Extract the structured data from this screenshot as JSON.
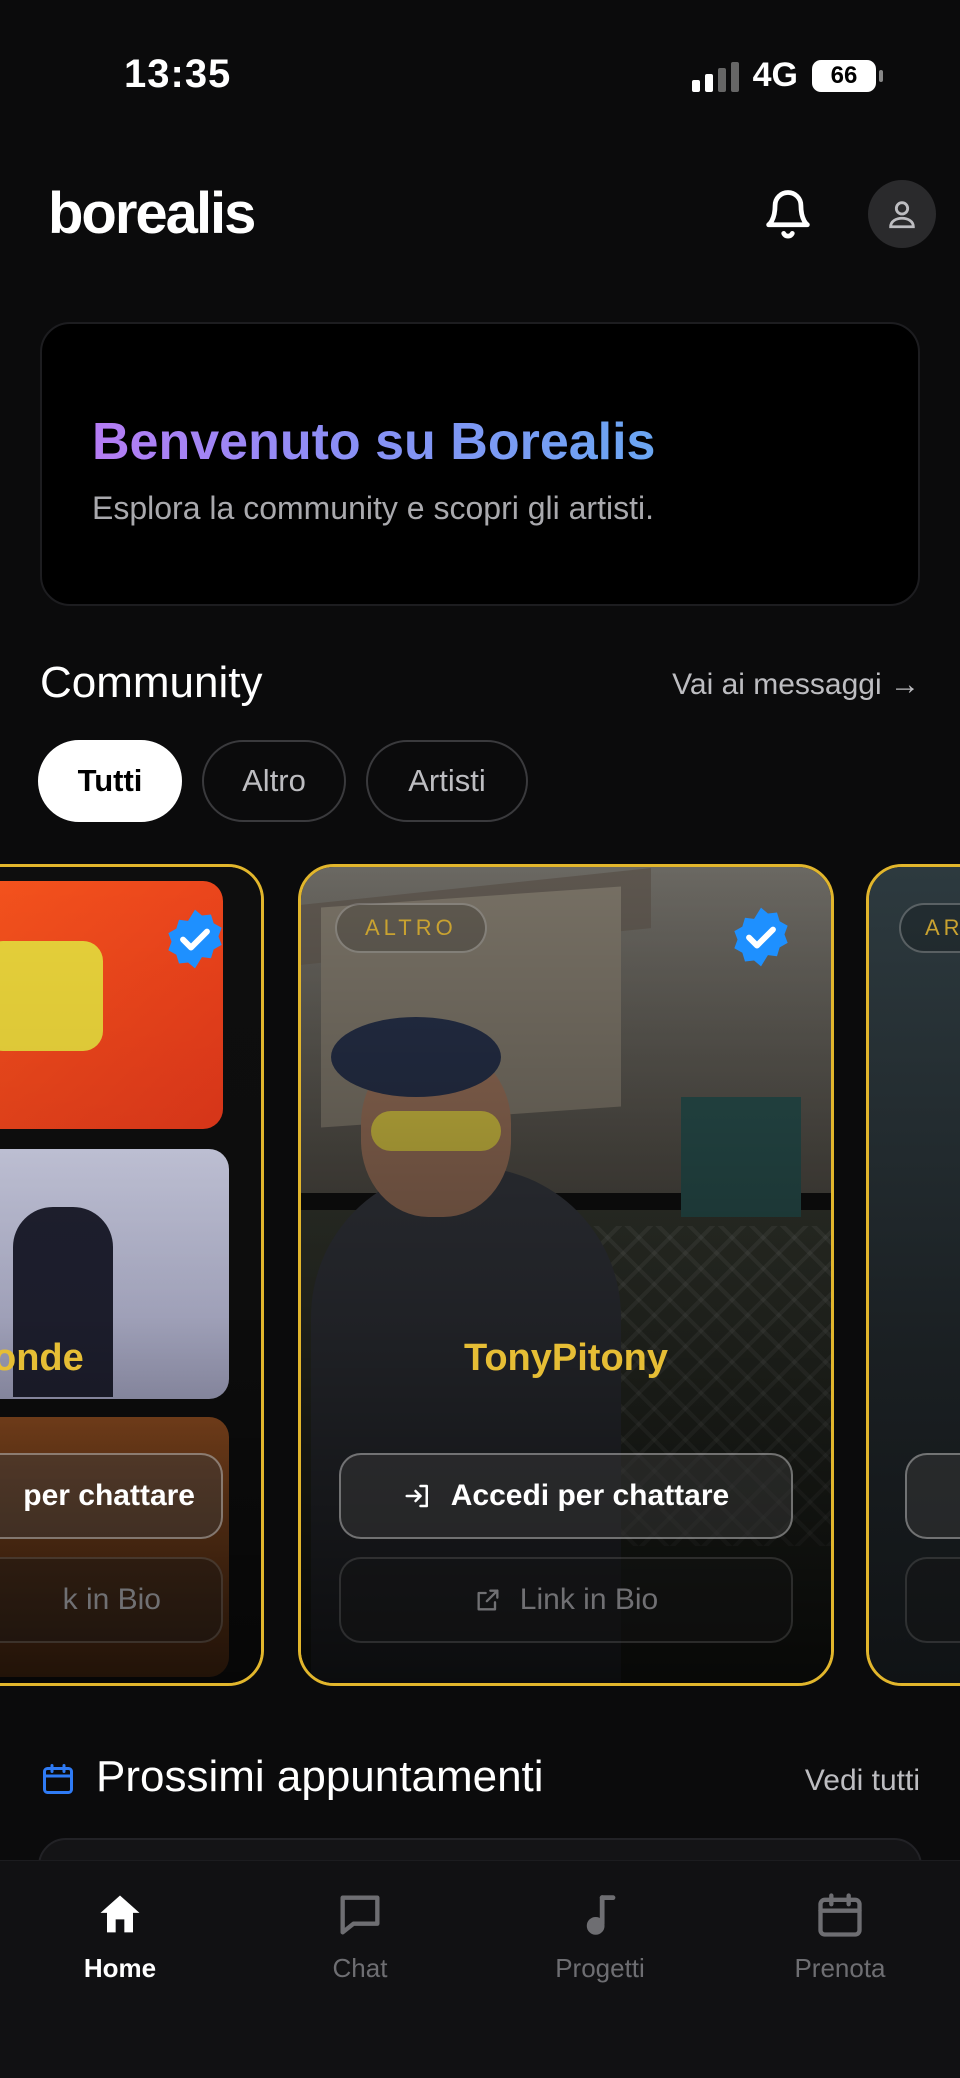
{
  "status_bar": {
    "time": "13:35",
    "network": "4G",
    "battery": "66"
  },
  "header": {
    "logo": "borealis"
  },
  "welcome": {
    "title": "Benvenuto su Borealis",
    "subtitle": "Esplora la community e scopri gli artisti."
  },
  "community": {
    "title": "Community",
    "link": "Vai ai messaggi →",
    "filters": [
      "Tutti",
      "Altro",
      "Artisti"
    ],
    "active_filter": "Tutti",
    "cards": [
      {
        "name": "onde",
        "login_label": "per chattare",
        "bio_label": "k in Bio",
        "verified": true
      },
      {
        "tag": "ALTRO",
        "name": "TonyPitony",
        "login_label": "Accedi per chattare",
        "bio_label": "Link in Bio",
        "verified": true
      },
      {
        "tag": "AR"
      }
    ]
  },
  "upcoming": {
    "title": "Prossimi appuntamenti",
    "link": "Vedi tutti"
  },
  "nav": {
    "items": [
      {
        "label": "Home",
        "icon": "home-icon",
        "active": true
      },
      {
        "label": "Chat",
        "icon": "chat-icon",
        "active": false
      },
      {
        "label": "Progetti",
        "icon": "music-note-icon",
        "active": false
      },
      {
        "label": "Prenota",
        "icon": "calendar-icon",
        "active": false
      }
    ]
  },
  "colors": {
    "accent_gold": "#e2b62c",
    "verified_blue": "#1e90ff",
    "calendar_blue": "#2f7bf5"
  }
}
